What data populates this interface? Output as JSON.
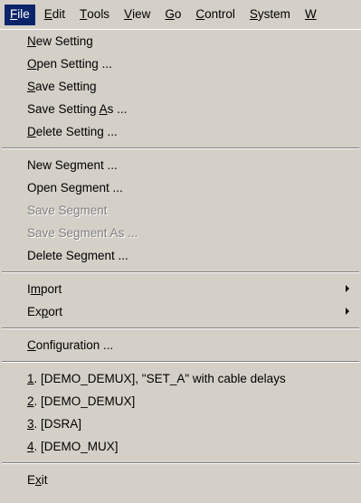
{
  "menubar": {
    "items": [
      {
        "mnemonic": "F",
        "rest": "ile"
      },
      {
        "mnemonic": "E",
        "rest": "dit"
      },
      {
        "mnemonic": "T",
        "rest": "ools"
      },
      {
        "mnemonic": "V",
        "rest": "iew"
      },
      {
        "mnemonic": "G",
        "rest": "o"
      },
      {
        "mnemonic": "C",
        "rest": "ontrol"
      },
      {
        "mnemonic": "S",
        "rest": "ystem"
      },
      {
        "mnemonic": "W",
        "rest": ""
      }
    ]
  },
  "file_menu": {
    "new_setting": {
      "pre": "",
      "mn": "N",
      "post": "ew Setting"
    },
    "open_setting": {
      "pre": "",
      "mn": "O",
      "post": "pen Setting ..."
    },
    "save_setting": {
      "pre": "",
      "mn": "S",
      "post": "ave Setting"
    },
    "save_setting_as": {
      "pre": "Save Setting ",
      "mn": "A",
      "post": "s ..."
    },
    "delete_setting": {
      "pre": "",
      "mn": "D",
      "post": "elete Setting ..."
    },
    "new_segment": "New Segment ...",
    "open_segment": "Open Segment ...",
    "save_segment": "Save Segment",
    "save_segment_as": "Save Segment As ...",
    "delete_segment": "Delete Segment ...",
    "import": {
      "pre": "I",
      "mn": "m",
      "post": "port"
    },
    "export": {
      "pre": "Ex",
      "mn": "p",
      "post": "ort"
    },
    "configuration": {
      "pre": "",
      "mn": "C",
      "post": "onfiguration ..."
    },
    "recent": [
      {
        "mn": "1",
        "post": ". [DEMO_DEMUX], \"SET_A\" with cable delays"
      },
      {
        "mn": "2",
        "post": ". [DEMO_DEMUX]"
      },
      {
        "mn": "3",
        "post": ". [DSRA]"
      },
      {
        "mn": "4",
        "post": ". [DEMO_MUX]"
      }
    ],
    "exit": {
      "pre": "E",
      "mn": "x",
      "post": "it"
    }
  },
  "colors": {
    "menu_background": "#d4d0c8",
    "highlight": "#0a246a",
    "disabled_text": "#808080"
  }
}
